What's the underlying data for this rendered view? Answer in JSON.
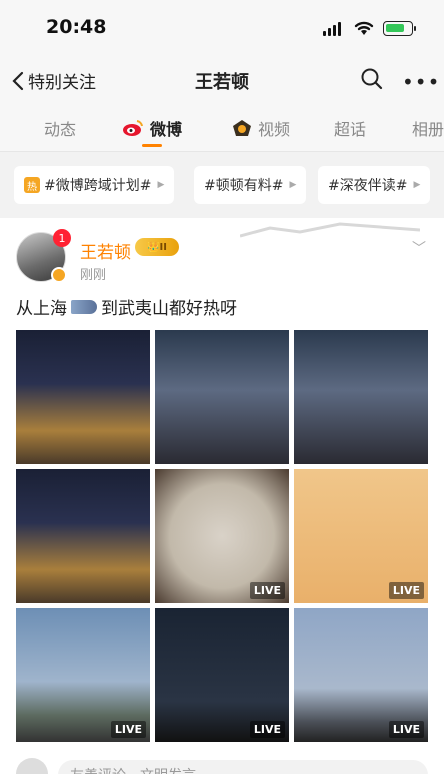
{
  "status": {
    "time": "20:48"
  },
  "navbar": {
    "back_label": "特别关注",
    "title": "王若顿"
  },
  "tabs": [
    {
      "label": "动态",
      "icon": null,
      "active": false
    },
    {
      "label": "微博",
      "icon": "weibo-icon",
      "active": true
    },
    {
      "label": "视频",
      "icon": "video-icon",
      "active": false
    },
    {
      "label": "超话",
      "icon": null,
      "active": false
    },
    {
      "label": "相册",
      "icon": null,
      "active": false
    }
  ],
  "topics": [
    {
      "label": "#微博跨域计划#",
      "hot_badge": "热"
    },
    {
      "label": "#顿顿有料#"
    },
    {
      "label": "#深夜伴读#"
    }
  ],
  "post": {
    "user": "王若顿",
    "level": "II",
    "notification_count": "1",
    "time": "刚刚",
    "text_before": "从上海",
    "text_after": "到武夷山都好热呀",
    "images": [
      {
        "scene": "city-night",
        "live": false
      },
      {
        "scene": "night-tower",
        "live": false
      },
      {
        "scene": "night-tower-glasses",
        "live": false
      },
      {
        "scene": "city-night",
        "live": false
      },
      {
        "scene": "buns",
        "live": true
      },
      {
        "scene": "soup",
        "live": true
      },
      {
        "scene": "mountain-dusk",
        "live": true
      },
      {
        "scene": "mountain-night",
        "live": true
      },
      {
        "scene": "mountain-sky",
        "live": true
      }
    ],
    "live_label": "LIVE"
  },
  "comment": {
    "placeholder": "友善评论，文明发言"
  },
  "colors": {
    "accent": "#ff8200",
    "username": "#ff8200"
  }
}
